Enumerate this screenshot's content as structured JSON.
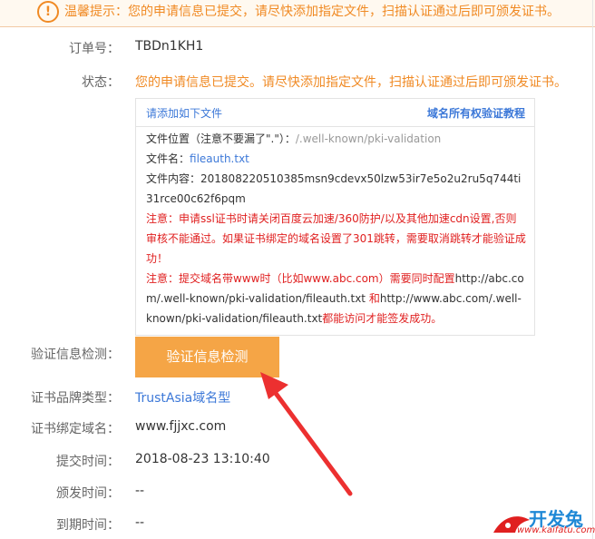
{
  "notice": {
    "text": "温馨提示：您的申请信息已提交，请尽快添加指定文件，扫描认证通过后即可颁发证书。"
  },
  "fields": {
    "order_no": {
      "label": "订单号：",
      "value": "TBDn1KH1"
    },
    "status": {
      "label": "状态：",
      "value": "您的申请信息已提交。请尽快添加指定文件，扫描认证通过后即可颁发证书。"
    },
    "verify_check": {
      "label": "验证信息检测：",
      "button": "验证信息检测"
    },
    "brand": {
      "label": "证书品牌类型：",
      "value": "TrustAsia域名型"
    },
    "domain": {
      "label": "证书绑定域名：",
      "value": "www.fjjxc.com"
    },
    "submit_time": {
      "label": "提交时间：",
      "value": "2018-08-23 13:10:40"
    },
    "issue_time": {
      "label": "颁发时间：",
      "value": "--"
    },
    "expire_time": {
      "label": "到期时间：",
      "value": "--"
    }
  },
  "file_box": {
    "header_left": "请添加如下文件",
    "header_right": "域名所有权验证教程",
    "location_label": "文件位置（注意不要漏了\".\"）：",
    "location_value": "/.well-known/pki-validation",
    "name_label": "文件名：",
    "name_value": "fileauth.txt",
    "content_label": "文件内容：",
    "content_value": "201808220510385msn9cdevx50lzw53ir7e5o2u2ru5q744ti31rce00c62f6pqm",
    "note1": "注意：申请ssl证书时请关闭百度云加速/360防护/以及其他加速cdn设置,否则审核不能通过。如果证书绑定的域名设置了301跳转，需要取消跳转才能验证成功！",
    "note2_prefix": "注意：提交域名带www时（比如www.abc.com）需要同时配置",
    "note2_url1": "http://abc.com/.well-known/pki-validation/fileauth.txt",
    "note2_and": " 和",
    "note2_url2": "http://www.abc.com/.well-known/pki-validation/fileauth.txt",
    "note2_suffix": "都能访问才能签发成功。"
  },
  "watermark": {
    "name": "开发兔",
    "url": "www.kaifatu.com"
  },
  "colors": {
    "accent_orange": "#f5a546",
    "status_orange": "#f08a24",
    "link_blue": "#3c78d8",
    "warning_red": "#e02020",
    "arrow_red": "#ec3030"
  }
}
